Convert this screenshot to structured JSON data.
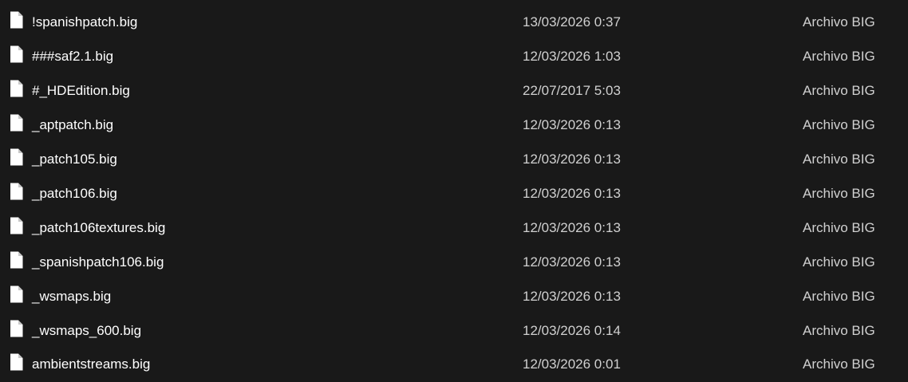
{
  "files": [
    {
      "name": "!spanishpatch.big",
      "date_modified": "13/03/2026 0:37",
      "type": "Archivo BIG",
      "icon": "file-icon"
    },
    {
      "name": "###saf2.1.big",
      "date_modified": "12/03/2026 1:03",
      "type": "Archivo BIG",
      "icon": "file-icon"
    },
    {
      "name": "#_HDEdition.big",
      "date_modified": "22/07/2017 5:03",
      "type": "Archivo BIG",
      "icon": "file-icon"
    },
    {
      "name": "_aptpatch.big",
      "date_modified": "12/03/2026 0:13",
      "type": "Archivo BIG",
      "icon": "file-icon"
    },
    {
      "name": "_patch105.big",
      "date_modified": "12/03/2026 0:13",
      "type": "Archivo BIG",
      "icon": "file-icon"
    },
    {
      "name": "_patch106.big",
      "date_modified": "12/03/2026 0:13",
      "type": "Archivo BIG",
      "icon": "file-icon"
    },
    {
      "name": "_patch106textures.big",
      "date_modified": "12/03/2026 0:13",
      "type": "Archivo BIG",
      "icon": "file-icon"
    },
    {
      "name": "_spanishpatch106.big",
      "date_modified": "12/03/2026 0:13",
      "type": "Archivo BIG",
      "icon": "file-icon"
    },
    {
      "name": "_wsmaps.big",
      "date_modified": "12/03/2026 0:13",
      "type": "Archivo BIG",
      "icon": "file-icon"
    },
    {
      "name": "_wsmaps_600.big",
      "date_modified": "12/03/2026 0:14",
      "type": "Archivo BIG",
      "icon": "file-icon"
    },
    {
      "name": "ambientstreams.big",
      "date_modified": "12/03/2026 0:01",
      "type": "Archivo BIG",
      "icon": "file-icon"
    }
  ],
  "colors": {
    "background": "#191919",
    "text": "#ffffff",
    "secondary_text": "#d0d0d0",
    "icon_fill": "#ffffff"
  }
}
